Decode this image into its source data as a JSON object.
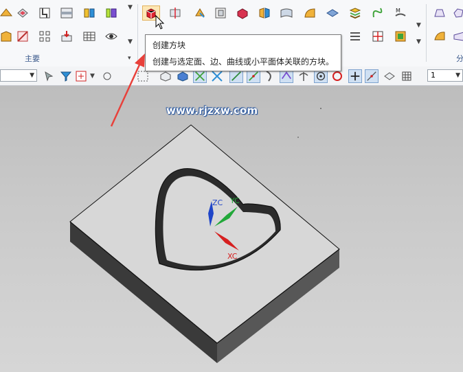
{
  "ribbon": {
    "groups": [
      {
        "label": "主要"
      },
      {
        "label": ""
      },
      {
        "label": "分"
      }
    ]
  },
  "tooltip": {
    "title": "创建方块",
    "description": "创建与选定面、边、曲线或小平面体关联的方块。"
  },
  "selection_bar": {
    "filter_value": "",
    "layer_value": "1"
  },
  "viewport": {
    "watermark": "www.rjzxw.com",
    "axes": {
      "x": "XC",
      "y": "YC",
      "z": "ZC"
    }
  },
  "colors": {
    "annotation_arrow": "#e8413b",
    "x_axis": "#d62020",
    "y_axis": "#22a83a",
    "z_axis": "#1f45c8"
  }
}
